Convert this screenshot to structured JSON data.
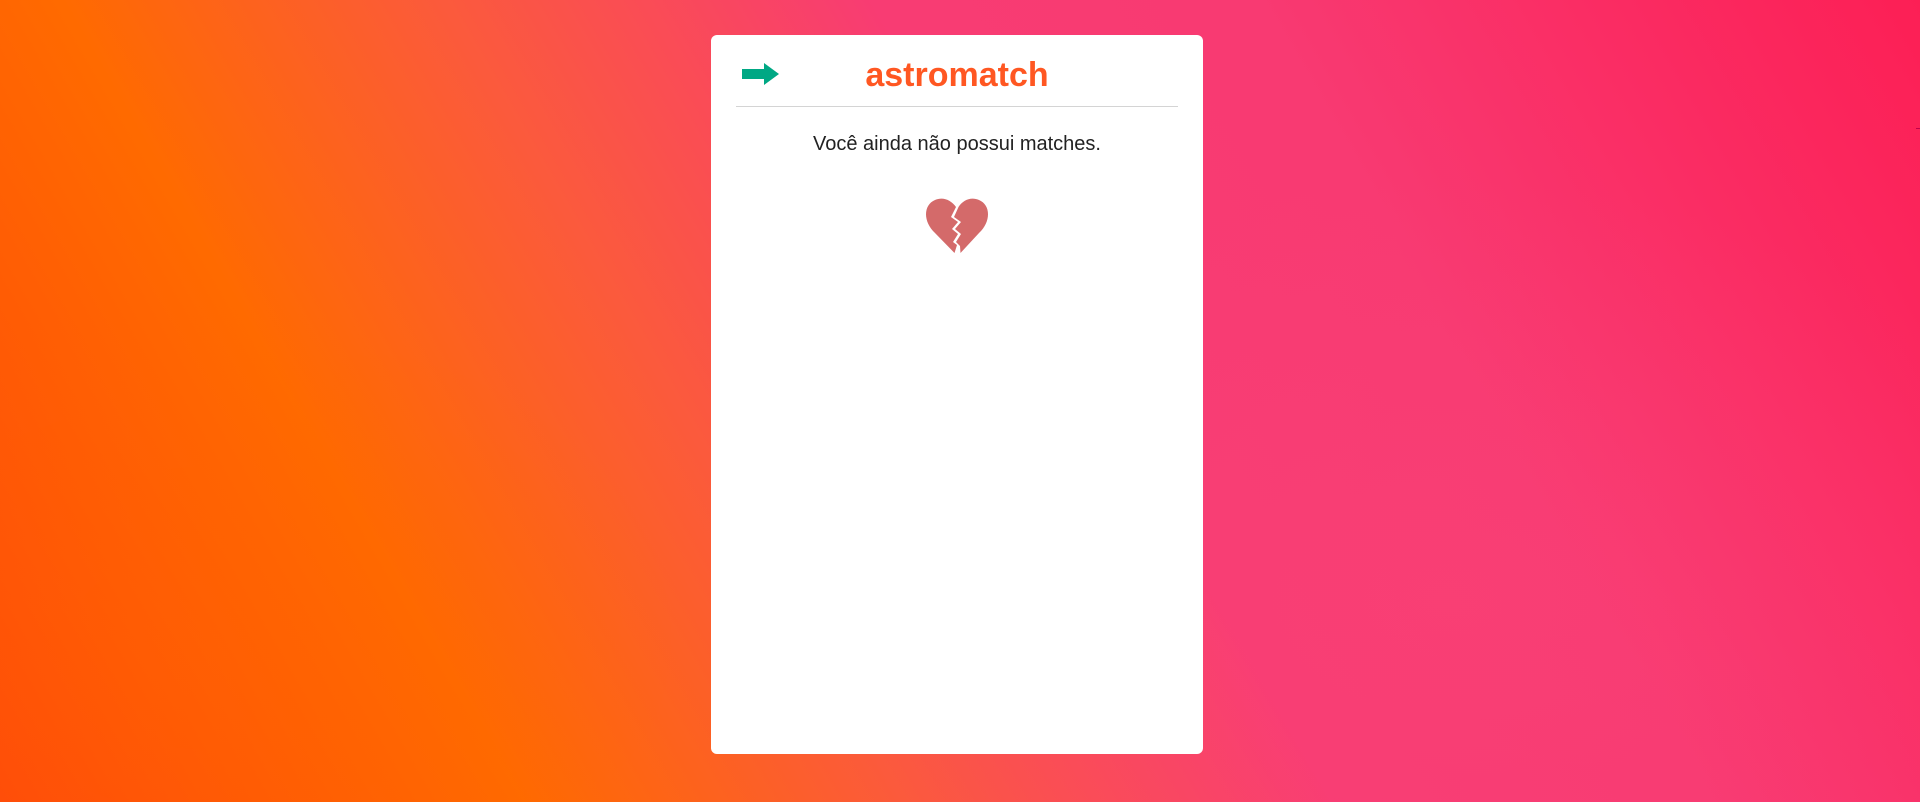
{
  "app": {
    "title": "astromatch",
    "title_color": "#ff5722"
  },
  "header": {
    "back_icon": "arrow-right-icon",
    "back_icon_color": "#00a884"
  },
  "matches": {
    "empty_message": "Você ainda não possui matches.",
    "empty_icon": "broken-heart-icon",
    "empty_icon_color": "#d46a6a",
    "items": []
  },
  "colors": {
    "background_gradient": [
      "#ff4a0a",
      "#ff6a00",
      "#f83c73",
      "#fc1f55"
    ],
    "card": "#ffffff",
    "divider": "#d4d4d4"
  }
}
